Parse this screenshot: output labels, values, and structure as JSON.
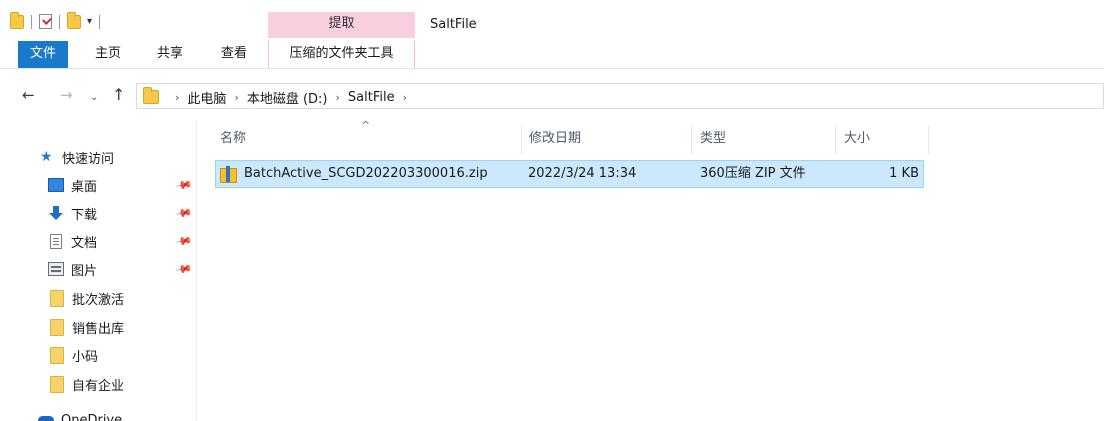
{
  "window": {
    "title": "SaltFile",
    "contextual_tab_group": "提取"
  },
  "ribbon": {
    "tabs": [
      {
        "label": "文件",
        "active": true
      },
      {
        "label": "主页"
      },
      {
        "label": "共享"
      },
      {
        "label": "查看"
      },
      {
        "label": "压缩的文件夹工具"
      }
    ]
  },
  "nav": {
    "back_icon": "←",
    "forward_icon": "→",
    "recent_icon": "⌄",
    "up_icon": "↑",
    "breadcrumbs": [
      "此电脑",
      "本地磁盘 (D:)",
      "SaltFile"
    ],
    "separator": "›"
  },
  "sidebar": {
    "quick_access": "快速访问",
    "items": [
      {
        "label": "桌面",
        "icon": "desktop-icon",
        "pinned": true
      },
      {
        "label": "下载",
        "icon": "download-icon",
        "pinned": true
      },
      {
        "label": "文档",
        "icon": "document-icon",
        "pinned": true
      },
      {
        "label": "图片",
        "icon": "pictures-icon",
        "pinned": true
      },
      {
        "label": "批次激活",
        "icon": "folder-icon",
        "pinned": false
      },
      {
        "label": "销售出库",
        "icon": "folder-icon",
        "pinned": false
      },
      {
        "label": "小码",
        "icon": "folder-icon",
        "pinned": false
      },
      {
        "label": "自有企业",
        "icon": "folder-icon",
        "pinned": false
      }
    ],
    "onedrive": "OneDrive",
    "pin_glyph": "📌"
  },
  "content": {
    "columns": {
      "name": "名称",
      "modified": "修改日期",
      "type": "类型",
      "size": "大小"
    },
    "sort_arrow": "^",
    "files": [
      {
        "name": "BatchActive_SCGD202203300016.zip",
        "modified": "2022/3/24 13:34",
        "type": "360压缩 ZIP 文件",
        "size": "1 KB",
        "selected": true,
        "icon": "zip-archive-icon"
      }
    ]
  },
  "colors": {
    "accent": "#1979ca",
    "selection_bg": "#cce8ff",
    "selection_border": "#99d1ff",
    "contextual_tab": "#f9cfe0"
  }
}
